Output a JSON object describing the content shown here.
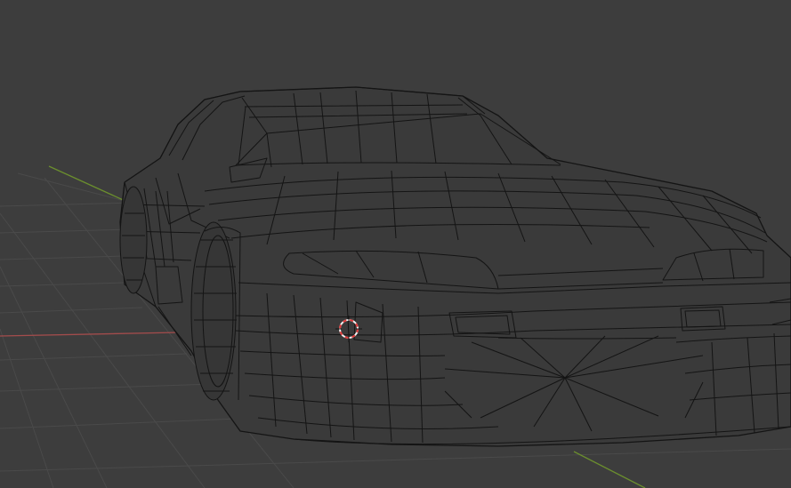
{
  "app": {
    "editor": "3D Viewport",
    "view_mode": "wireframe",
    "object": "car-body-mesh"
  },
  "colors": {
    "background": "#3d3d3d",
    "grid": "#4a4a4a",
    "x_axis": "#a34c4c",
    "y_axis": "#6b8e2e",
    "wire": "#141414",
    "surface": "#3a3a3a",
    "cursor_red": "#e23a3a",
    "cursor_white": "#f2f2f2"
  },
  "icons": [
    "3d-cursor-icon"
  ]
}
